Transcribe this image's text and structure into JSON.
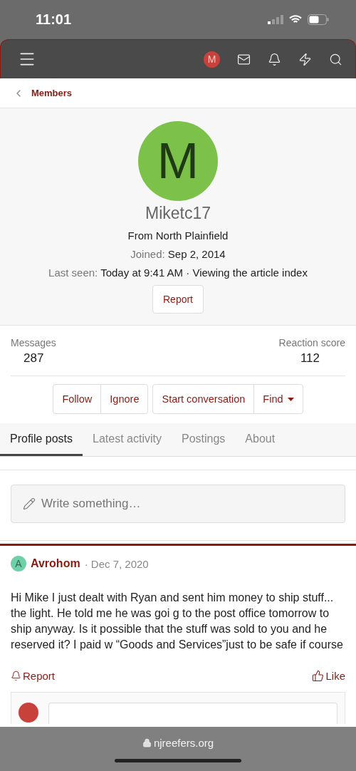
{
  "status_bar": {
    "time": "11:01"
  },
  "nav": {
    "avatar_letter": "M"
  },
  "breadcrumb": {
    "label": "Members"
  },
  "profile": {
    "avatar_letter": "M",
    "username": "Miketc17",
    "location": "From North Plainfield",
    "joined_label": "Joined:",
    "joined": "Sep 2, 2014",
    "last_seen_label": "Last seen:",
    "last_seen": "Today at 9:41 AM · Viewing the article index",
    "report_button": "Report"
  },
  "stats": [
    {
      "label": "Messages",
      "value": "287"
    },
    {
      "label": "Reaction score",
      "value": "112"
    }
  ],
  "actions": [
    [
      "Follow",
      "Ignore"
    ],
    [
      "Start conversation",
      "Find"
    ]
  ],
  "tabs": [
    {
      "label": "Profile posts",
      "selected": true
    },
    {
      "label": "Latest activity",
      "selected": false
    },
    {
      "label": "Postings",
      "selected": false
    },
    {
      "label": "About",
      "selected": false
    }
  ],
  "composer": {
    "placeholder": "Write something…"
  },
  "posts": [
    {
      "avatar_letter": "A",
      "author": "Avrohom",
      "date": "· Dec 7, 2020",
      "body": "Hi Mike I just dealt with Ryan and sent him money to ship stuff...\nthe light. He told me he was goi g to the post office tomorrow to ship anyway. Is it possible that the stuff was sold to you and he reserved it? I paid w “Goods and Services”just to be safe if course",
      "report": "Report",
      "like": "Like"
    }
  ],
  "browser": {
    "url": "njreefers.org"
  }
}
